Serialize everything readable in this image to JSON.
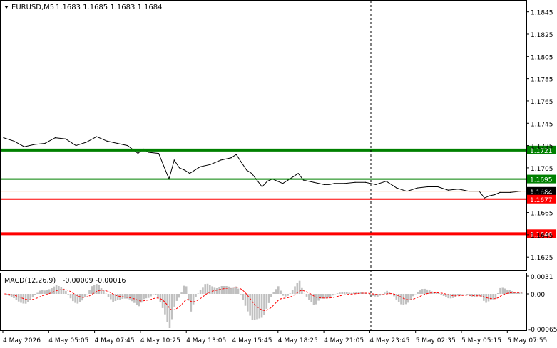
{
  "header": {
    "symbol": "EURUSD,M5",
    "ohlc": "1.1683 1.1685 1.1683 1.1684"
  },
  "macd": {
    "label": "MACD(12,26,9)",
    "values": "-0.00009 -0.00016",
    "ticks": [
      "0.0031",
      "0.00",
      "-0.00065"
    ]
  },
  "colors": {
    "price_line": "#000000",
    "macd_hist": "#c0c0c0",
    "macd_signal": "#ff0000",
    "support": "#ff0000",
    "resistance": "#008000",
    "bid_line": "#ffc8a0",
    "cursor_line": "#000000"
  },
  "chart_data": {
    "type": "line",
    "title": "EURUSD,M5",
    "ylim": [
      1.1613,
      1.1855
    ],
    "y_ticks": [
      "1.1845",
      "1.1825",
      "1.1805",
      "1.1785",
      "1.1765",
      "1.1745",
      "1.1725",
      "1.1705",
      "1.1685",
      "1.1665",
      "1.1645",
      "1.1625"
    ],
    "x_ticks": [
      "4 May 2026",
      "4 May 05:05",
      "4 May 07:45",
      "4 May 10:25",
      "4 May 13:05",
      "4 May 15:45",
      "4 May 18:25",
      "4 May 21:05",
      "4 May 23:45",
      "5 May 02:35",
      "5 May 05:15",
      "5 May 07:55"
    ],
    "levels": [
      {
        "value": 1.1721,
        "label": "1.1721",
        "role": "resistance-strong"
      },
      {
        "value": 1.1695,
        "label": "1.1695",
        "role": "resistance"
      },
      {
        "value": 1.1684,
        "label": "1.1684",
        "role": "current"
      },
      {
        "value": 1.1677,
        "label": "1.1677",
        "role": "support"
      },
      {
        "value": 1.1646,
        "label": "1.1646",
        "role": "support-strong"
      }
    ],
    "series": [
      {
        "x": [
          0,
          0.02,
          0.04,
          0.06,
          0.08,
          0.1,
          0.12,
          0.14,
          0.16,
          0.18,
          0.2,
          0.22,
          0.24,
          0.26,
          0.27,
          0.28,
          0.3,
          0.32,
          0.33,
          0.34,
          0.35,
          0.36,
          0.38,
          0.4,
          0.42,
          0.44,
          0.45,
          0.46,
          0.47,
          0.48,
          0.5,
          0.51,
          0.52,
          0.53,
          0.54,
          0.55,
          0.56,
          0.57,
          0.58,
          0.6,
          0.62,
          0.63,
          0.64,
          0.66,
          0.68,
          0.7,
          0.72,
          0.74,
          0.76,
          0.78,
          0.8,
          0.82,
          0.84,
          0.86,
          0.88,
          0.9,
          0.92,
          0.93,
          0.94,
          0.95,
          0.96,
          0.98,
          1.0
        ],
        "values": [
          1.1732,
          1.1729,
          1.1724,
          1.1726,
          1.1727,
          1.1732,
          1.1731,
          1.1725,
          1.1728,
          1.1733,
          1.1729,
          1.1727,
          1.1725,
          1.1718,
          1.1722,
          1.1719,
          1.1718,
          1.1695,
          1.1712,
          1.1705,
          1.1703,
          1.17,
          1.1706,
          1.1708,
          1.1712,
          1.1714,
          1.1717,
          1.171,
          1.1703,
          1.17,
          1.1688,
          1.1693,
          1.1695,
          1.1693,
          1.1691,
          1.1694,
          1.1697,
          1.17,
          1.1694,
          1.1692,
          1.169,
          1.169,
          1.1691,
          1.1691,
          1.1692,
          1.1692,
          1.169,
          1.1693,
          1.1687,
          1.1684,
          1.1687,
          1.1688,
          1.1688,
          1.1685,
          1.1686,
          1.1684,
          1.1684,
          1.1678,
          1.168,
          1.1681,
          1.1683,
          1.1683,
          1.1684
        ]
      }
    ]
  }
}
